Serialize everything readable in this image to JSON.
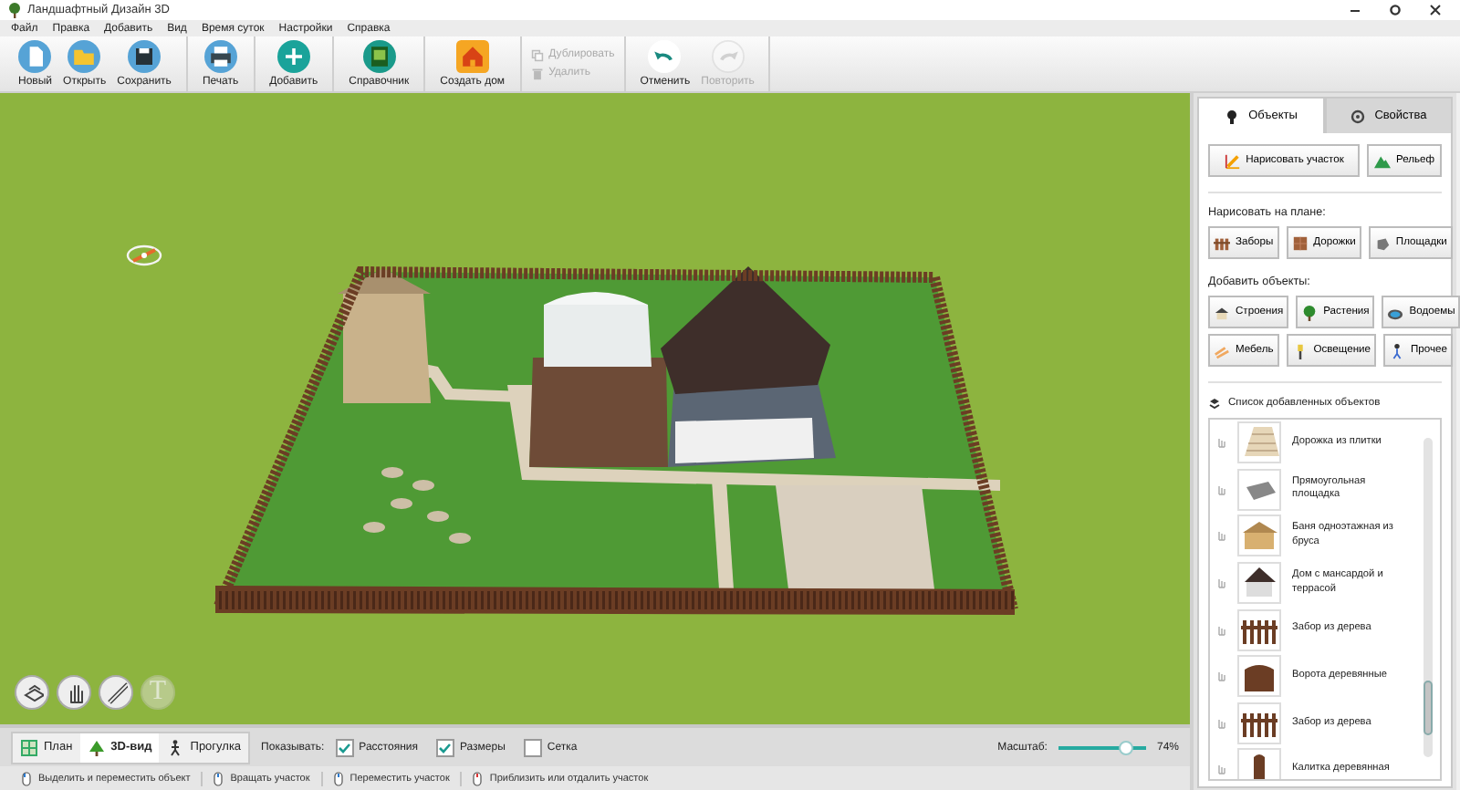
{
  "window": {
    "title": "Ландшафтный Дизайн 3D"
  },
  "menu": [
    "Файл",
    "Правка",
    "Добавить",
    "Вид",
    "Время суток",
    "Настройки",
    "Справка"
  ],
  "toolbar_groups": [
    {
      "items": [
        {
          "label": "Новый",
          "kind": "large",
          "disabled": false
        },
        {
          "label": "Открыть",
          "kind": "large",
          "disabled": false
        },
        {
          "label": "Сохранить",
          "kind": "large",
          "disabled": false
        }
      ]
    },
    {
      "items": [
        {
          "label": "Печать",
          "kind": "large",
          "disabled": false
        }
      ]
    },
    {
      "items": [
        {
          "label": "Добавить",
          "kind": "large",
          "disabled": false
        }
      ]
    },
    {
      "items": [
        {
          "label": "Справочник",
          "kind": "large",
          "disabled": false
        }
      ]
    },
    {
      "items": [
        {
          "label": "Создать дом",
          "kind": "large",
          "disabled": false
        }
      ]
    },
    {
      "items": [
        {
          "label": "Дублировать",
          "kind": "small",
          "disabled": true
        },
        {
          "label": "Удалить",
          "kind": "small",
          "disabled": true
        }
      ]
    },
    {
      "items": [
        {
          "label": "Отменить",
          "kind": "large",
          "disabled": false
        },
        {
          "label": "Повторить",
          "kind": "large",
          "disabled": true
        }
      ]
    }
  ],
  "viewport": {
    "tools": [
      {
        "disabled": false
      },
      {
        "disabled": false
      },
      {
        "disabled": false
      },
      {
        "glyph": "T",
        "disabled": true
      }
    ]
  },
  "bottom_bar": {
    "view_tabs": [
      {
        "label": "План",
        "selected": false
      },
      {
        "label": "3D-вид",
        "selected": true
      },
      {
        "label": "Прогулка",
        "selected": false
      }
    ],
    "show_label": "Показывать:",
    "checkboxes": [
      {
        "label": "Расстояния",
        "checked": true
      },
      {
        "label": "Размеры",
        "checked": true
      },
      {
        "label": "Сетка",
        "checked": false
      }
    ],
    "zoom": {
      "label": "Масштаб:",
      "level": 0.74,
      "reading": "74%"
    }
  },
  "status_bar": {
    "hints": [
      "Выделить и переместить объект",
      "Вращать участок",
      "Переместить участок",
      "Приблизить или отдалить участок"
    ]
  },
  "side_panel": {
    "tabs": [
      {
        "label": "Объекты",
        "selected": true
      },
      {
        "label": "Свойства",
        "selected": false
      }
    ],
    "primary_buttons": [
      "Нарисовать участок",
      "Рельеф"
    ],
    "draw_heading": "Нарисовать на плане:",
    "draw_buttons": [
      "Заборы",
      "Дорожки",
      "Площадки"
    ],
    "add_heading": "Добавить объекты:",
    "add_buttons": [
      "Строения",
      "Растения",
      "Водоемы",
      "Мебель",
      "Освещение",
      "Прочее"
    ],
    "list_title": "Список добавленных объектов",
    "list_items": [
      "Дорожка из плитки",
      "Прямоугольная площадка",
      "Баня одноэтажная из бруса",
      "Дом с мансардой и террасой",
      "Забор из дерева",
      "Ворота деревянные",
      "Забор из дерева",
      "Калитка деревянная"
    ]
  }
}
